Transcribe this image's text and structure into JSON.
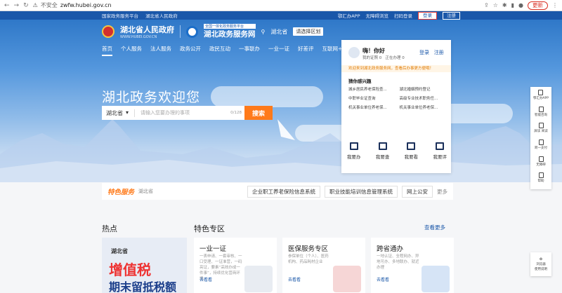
{
  "browser": {
    "not_secure": "不安全",
    "url": "zwfw.hubei.gov.cn",
    "update": "更新"
  },
  "topbar": {
    "left": [
      "国家政务服务平台",
      "湖北省人民政府"
    ],
    "right": [
      "鄂汇办APP",
      "无障碍浏览",
      "扫码登录",
      "登录",
      "注册"
    ]
  },
  "header": {
    "gov_title": "湖北省人民政府",
    "gov_sub": "WWW.HUBEI.GOV.CN",
    "service_tag": "全国一体化政务服务平台",
    "service_title": "湖北政务服务网",
    "location": "湖北省",
    "region_btn": "请选择区划"
  },
  "menu": [
    "首页",
    "个人服务",
    "法人服务",
    "政务公开",
    "政民互动",
    "一事联办",
    "一业一证",
    "好差评",
    "互联网+监管"
  ],
  "hero": {
    "welcome": "湖北政务欢迎您"
  },
  "search": {
    "province": "湖北省",
    "placeholder": "请输入您要办理的事项",
    "count": "0/128",
    "button": "搜索"
  },
  "card": {
    "greeting": "嗨！你好",
    "sub1": "我的证照 0",
    "sub2": "正在办理 0",
    "login": "登录",
    "register": "注册",
    "notice": "欢迎来到湖北政务服务网，查看后办事更方便哦！",
    "section": "猜你感兴趣",
    "items": [
      "城乡居民养老保险查...",
      "湖北婚姻预约登记",
      "中职毕业证查询",
      "高级专业技术职务任...",
      "机关事业单位养老保...",
      "机关事业单位养老保..."
    ],
    "actions": [
      "我要办",
      "我要查",
      "我要看",
      "我要评"
    ]
  },
  "featured": {
    "title": "特色服务",
    "location": "湖北省",
    "links": [
      "企业职工养老保险信息系统",
      "职业技能培训信息管理系统",
      "网上公安"
    ],
    "more": "更多"
  },
  "sections": {
    "hot": "热点",
    "special": "特色专区",
    "view_more": "查看更多"
  },
  "hot_banner": {
    "line1": "湖北省",
    "line2": "增值税",
    "line3": "期末留抵税额"
  },
  "tiles": [
    {
      "title": "一业一证",
      "desc": "一表申请、一套审核、一口受理、一证准营，一码亮证，要素“高效办成一件事”，持续优化营商环境",
      "go": "去看看"
    },
    {
      "title": "医保服务专区",
      "desc": "参保单位（个人）、医药机构、药品耗材企业",
      "go": "去看看"
    },
    {
      "title": "跨省通办",
      "desc": "一地认证、全程网办、异地可办、多地联办、就近办理",
      "go": "去看看"
    }
  ],
  "side": [
    "鄂汇办APP",
    "智能咨询",
    "屏读 阅读",
    "跨一支付",
    "无障碍",
    "帮助"
  ],
  "side2": [
    "浏览器",
    "使用说明"
  ]
}
